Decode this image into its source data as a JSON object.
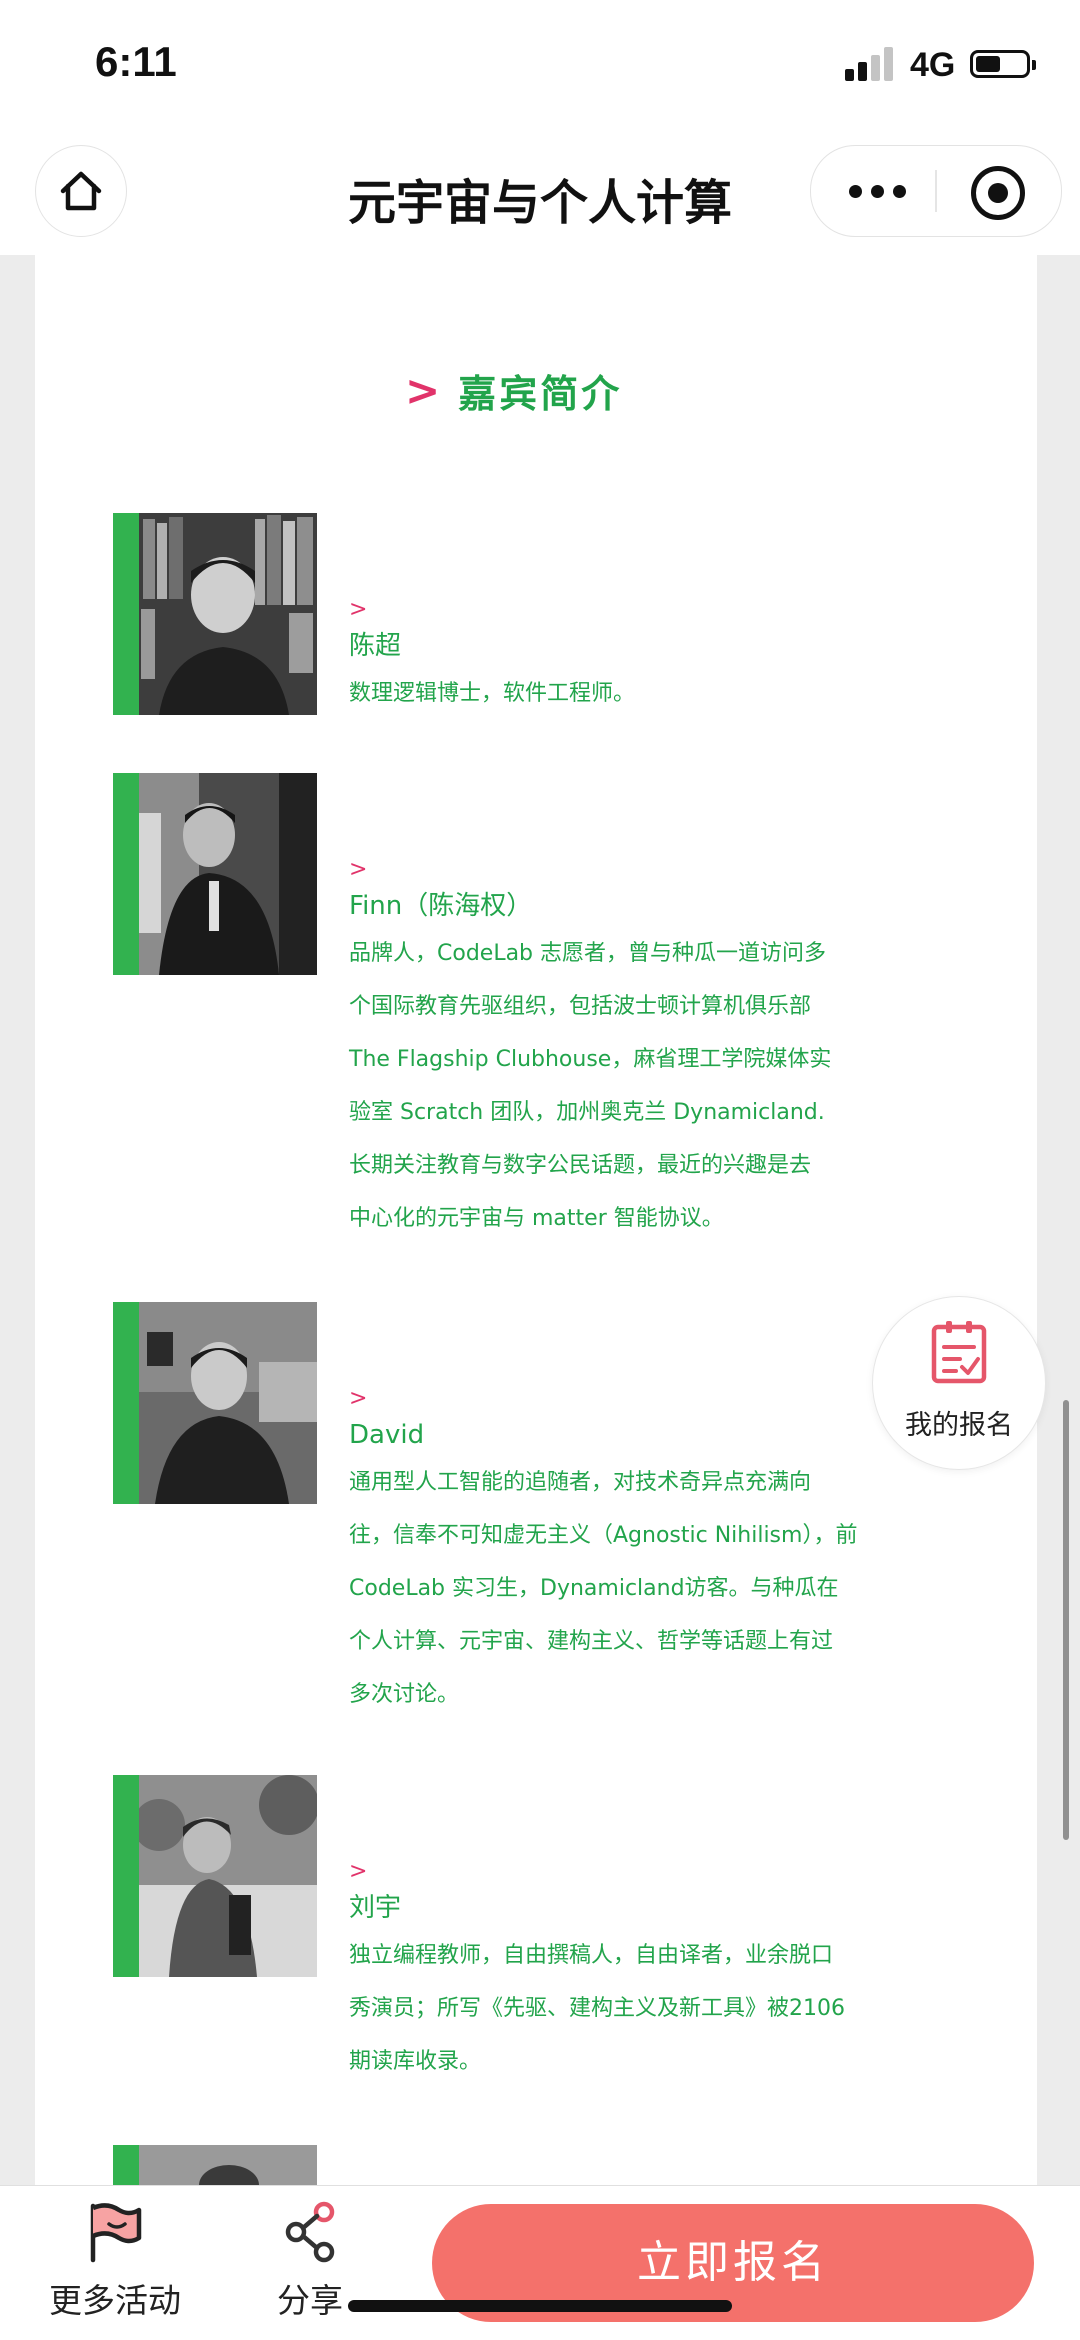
{
  "status_bar": {
    "time": "6:11",
    "network": "4G"
  },
  "nav": {
    "title": "元宇宙与个人计算"
  },
  "section": {
    "arrow": ">",
    "heading": "嘉宾简介"
  },
  "guests": [
    {
      "arrow": ">",
      "name": "陈超",
      "lines": [
        "数理逻辑博士，软件工程师。"
      ]
    },
    {
      "arrow": ">",
      "name": "Finn（陈海权）",
      "lines": [
        "品牌人，CodeLab 志愿者，曾与种瓜一道访问多",
        "个国际教育先驱组织，包括波士顿计算机俱乐部",
        "The Flagship Clubhouse，麻省理工学院媒体实",
        "验室 Scratch 团队，加州奥克兰 Dynamicland.",
        "长期关注教育与数字公民话题，最近的兴趣是去",
        "中心化的元宇宙与 matter 智能协议。"
      ]
    },
    {
      "arrow": ">",
      "name": "David",
      "lines": [
        "通用型人工智能的追随者，对技术奇异点充满向",
        "往，信奉不可知虚无主义（Agnostic Nihilism），前",
        "CodeLab 实习生，Dynamicland访客。与种瓜在",
        "个人计算、元宇宙、建构主义、哲学等话题上有过",
        "多次讨论。"
      ]
    },
    {
      "arrow": ">",
      "name": "刘宇",
      "lines": [
        "独立编程教师，自由撰稿人，自由译者，业余脱口",
        "秀演员；所写《先驱、建构主义及新工具》被2106",
        "期读库收录。"
      ]
    }
  ],
  "float_button": {
    "label": "我的报名"
  },
  "bottom_bar": {
    "more_label": "更多活动",
    "share_label": "分享",
    "signup_label": "立即报名"
  },
  "colors": {
    "accent_green": "#22a44b",
    "accent_pink": "#e1336a",
    "signup_bg": "#f4716b"
  }
}
